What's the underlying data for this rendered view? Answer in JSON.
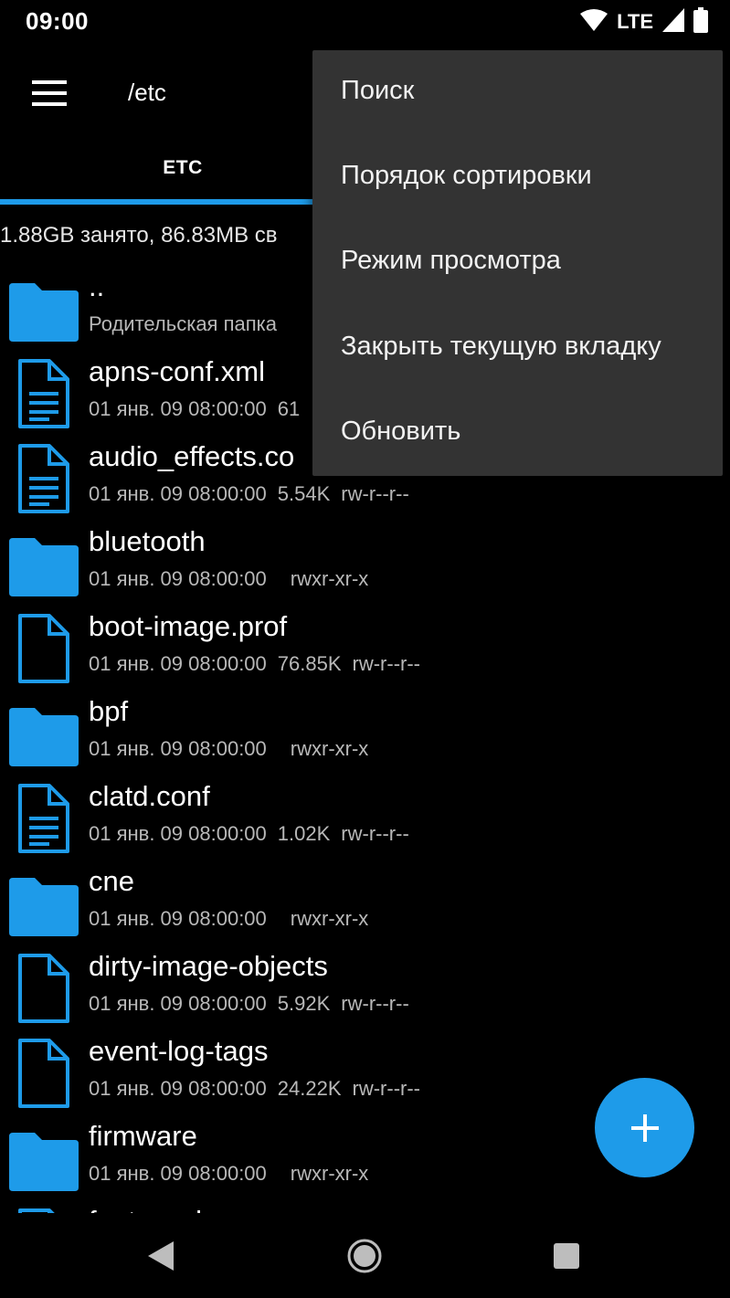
{
  "status_bar": {
    "time": "09:00",
    "network": "LTE"
  },
  "app_bar": {
    "path": "/etc"
  },
  "tabs": [
    {
      "label": "ETC"
    }
  ],
  "storage_info": "1.88GB занято, 86.83MB св",
  "files": [
    {
      "name": "..",
      "meta": "Родительская папка",
      "size": "",
      "perm": "",
      "icon": "folder-icon",
      "type": "parent"
    },
    {
      "name": "apns-conf.xml",
      "meta": "01 янв. 09 08:00:00",
      "size": "61",
      "perm": "",
      "icon": "document-icon",
      "type": "file"
    },
    {
      "name": "audio_effects.co",
      "meta": "01 янв. 09 08:00:00",
      "size": "5.54K",
      "perm": "rw-r--r--",
      "icon": "document-icon",
      "type": "file"
    },
    {
      "name": "bluetooth",
      "meta": "01 янв. 09 08:00:00",
      "size": "",
      "perm": "rwxr-xr-x",
      "icon": "folder-icon",
      "type": "dir"
    },
    {
      "name": "boot-image.prof",
      "meta": "01 янв. 09 08:00:00",
      "size": "76.85K",
      "perm": "rw-r--r--",
      "icon": "file-icon",
      "type": "file"
    },
    {
      "name": "bpf",
      "meta": "01 янв. 09 08:00:00",
      "size": "",
      "perm": "rwxr-xr-x",
      "icon": "folder-icon",
      "type": "dir"
    },
    {
      "name": "clatd.conf",
      "meta": "01 янв. 09 08:00:00",
      "size": "1.02K",
      "perm": "rw-r--r--",
      "icon": "document-icon",
      "type": "file"
    },
    {
      "name": "cne",
      "meta": "01 янв. 09 08:00:00",
      "size": "",
      "perm": "rwxr-xr-x",
      "icon": "folder-icon",
      "type": "dir"
    },
    {
      "name": "dirty-image-objects",
      "meta": "01 янв. 09 08:00:00",
      "size": "5.92K",
      "perm": "rw-r--r--",
      "icon": "file-icon",
      "type": "file"
    },
    {
      "name": "event-log-tags",
      "meta": "01 янв. 09 08:00:00",
      "size": "24.22K",
      "perm": "rw-r--r--",
      "icon": "file-icon",
      "type": "file"
    },
    {
      "name": "firmware",
      "meta": "01 янв. 09 08:00:00",
      "size": "",
      "perm": "rwxr-xr-x",
      "icon": "folder-icon",
      "type": "dir"
    },
    {
      "name": "fonts.xml",
      "meta": "",
      "size": "",
      "perm": "",
      "icon": "document-icon",
      "type": "file"
    }
  ],
  "popup_menu": [
    {
      "label": "Поиск"
    },
    {
      "label": "Порядок сортировки"
    },
    {
      "label": "Режим просмотра"
    },
    {
      "label": "Закрыть текущую вкладку"
    },
    {
      "label": "Обновить"
    }
  ],
  "fab": {
    "icon": "plus-icon"
  },
  "colors": {
    "accent": "#1e9be9",
    "menu_bg": "#333333",
    "background": "#000000"
  }
}
